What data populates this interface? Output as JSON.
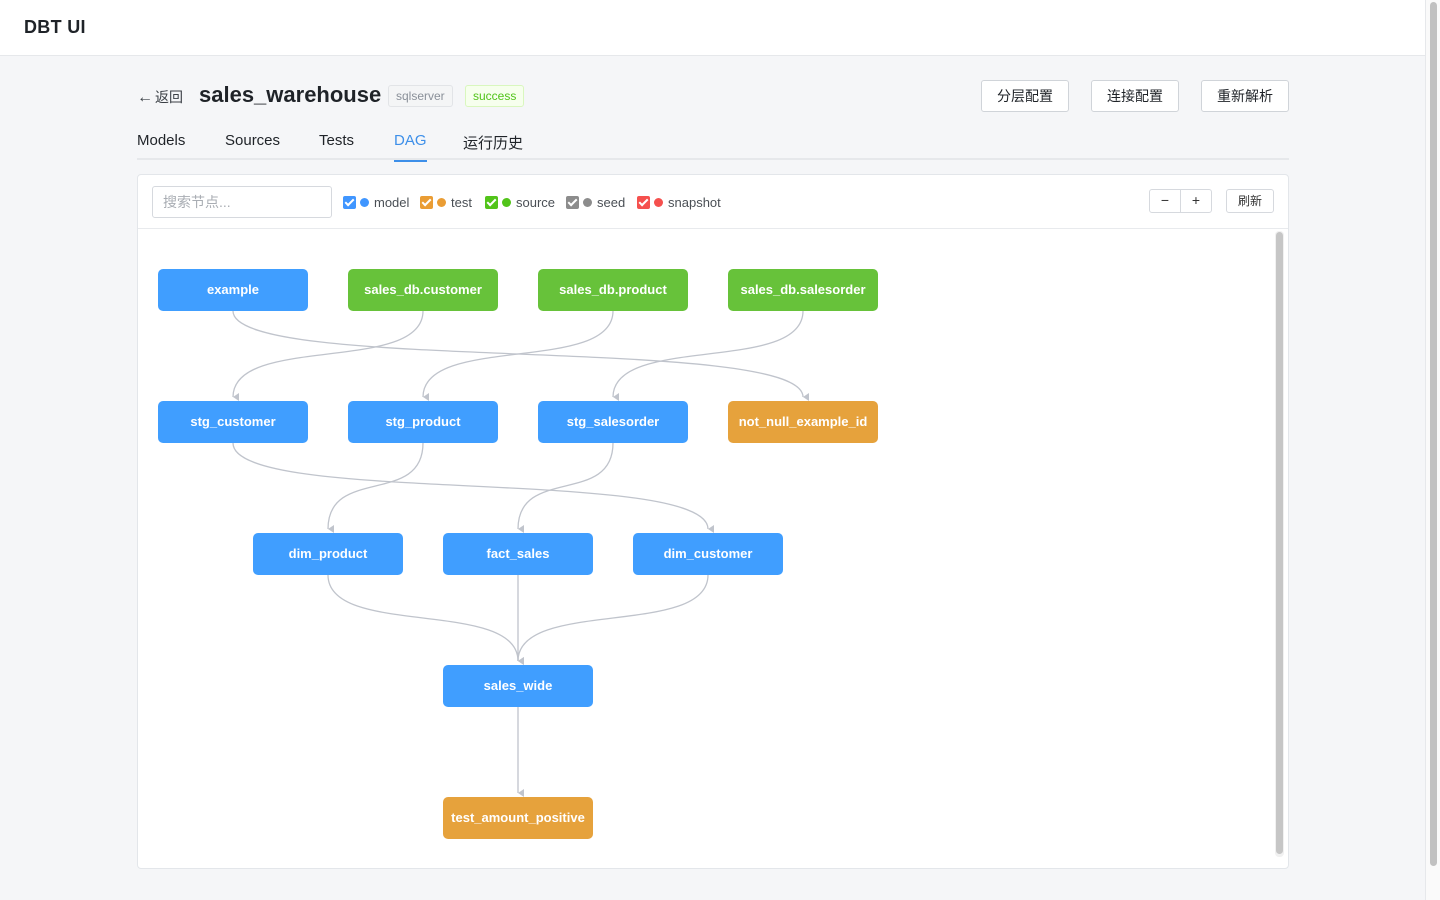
{
  "app": {
    "title": "DBT UI"
  },
  "header": {
    "back_label": "返回",
    "back_arrow": "←",
    "project_name": "sales_warehouse",
    "db_type": "sqlserver",
    "status": "success",
    "buttons": {
      "layer_config": "分层配置",
      "connection_config": "连接配置",
      "reparse": "重新解析"
    }
  },
  "tabs": [
    {
      "label": "Models",
      "active": false
    },
    {
      "label": "Sources",
      "active": false
    },
    {
      "label": "Tests",
      "active": false
    },
    {
      "label": "DAG",
      "active": true
    },
    {
      "label": "运行历史",
      "active": false
    }
  ],
  "toolbar": {
    "search_placeholder": "搜索节点...",
    "filters": [
      {
        "label": "model",
        "checked": true,
        "color": "#4096ff"
      },
      {
        "label": "test",
        "checked": true,
        "color": "#ea9d34"
      },
      {
        "label": "source",
        "checked": true,
        "color": "#52c41a"
      },
      {
        "label": "seed",
        "checked": true,
        "color": "#8c8c8c"
      },
      {
        "label": "snapshot",
        "checked": true,
        "color": "#f5504e"
      }
    ],
    "zoom_out": "−",
    "zoom_in": "+",
    "refresh": "刷新"
  },
  "colors": {
    "model": "#409eff",
    "source": "#67c23a",
    "test": "#e6a23c",
    "edge": "#c0c4cc",
    "accent": "#3d8fe9"
  },
  "dag": {
    "nodes": [
      {
        "id": "example",
        "label": "example",
        "type": "model"
      },
      {
        "id": "sales_db.customer",
        "label": "sales_db.customer",
        "type": "source"
      },
      {
        "id": "sales_db.product",
        "label": "sales_db.product",
        "type": "source"
      },
      {
        "id": "sales_db.salesorder",
        "label": "sales_db.salesorder",
        "type": "source"
      },
      {
        "id": "stg_customer",
        "label": "stg_customer",
        "type": "model"
      },
      {
        "id": "stg_product",
        "label": "stg_product",
        "type": "model"
      },
      {
        "id": "stg_salesorder",
        "label": "stg_salesorder",
        "type": "model"
      },
      {
        "id": "not_null_example_id",
        "label": "not_null_example_id",
        "type": "test"
      },
      {
        "id": "dim_product",
        "label": "dim_product",
        "type": "model"
      },
      {
        "id": "fact_sales",
        "label": "fact_sales",
        "type": "model"
      },
      {
        "id": "dim_customer",
        "label": "dim_customer",
        "type": "model"
      },
      {
        "id": "sales_wide",
        "label": "sales_wide",
        "type": "model"
      },
      {
        "id": "test_amount_positive",
        "label": "test_amount_positive",
        "type": "test"
      }
    ],
    "edges": [
      [
        "example",
        "not_null_example_id"
      ],
      [
        "sales_db.customer",
        "stg_customer"
      ],
      [
        "sales_db.product",
        "stg_product"
      ],
      [
        "sales_db.salesorder",
        "stg_salesorder"
      ],
      [
        "stg_customer",
        "dim_customer"
      ],
      [
        "stg_product",
        "dim_product"
      ],
      [
        "stg_salesorder",
        "fact_sales"
      ],
      [
        "dim_product",
        "sales_wide"
      ],
      [
        "fact_sales",
        "sales_wide"
      ],
      [
        "dim_customer",
        "sales_wide"
      ],
      [
        "sales_wide",
        "test_amount_positive"
      ]
    ]
  }
}
